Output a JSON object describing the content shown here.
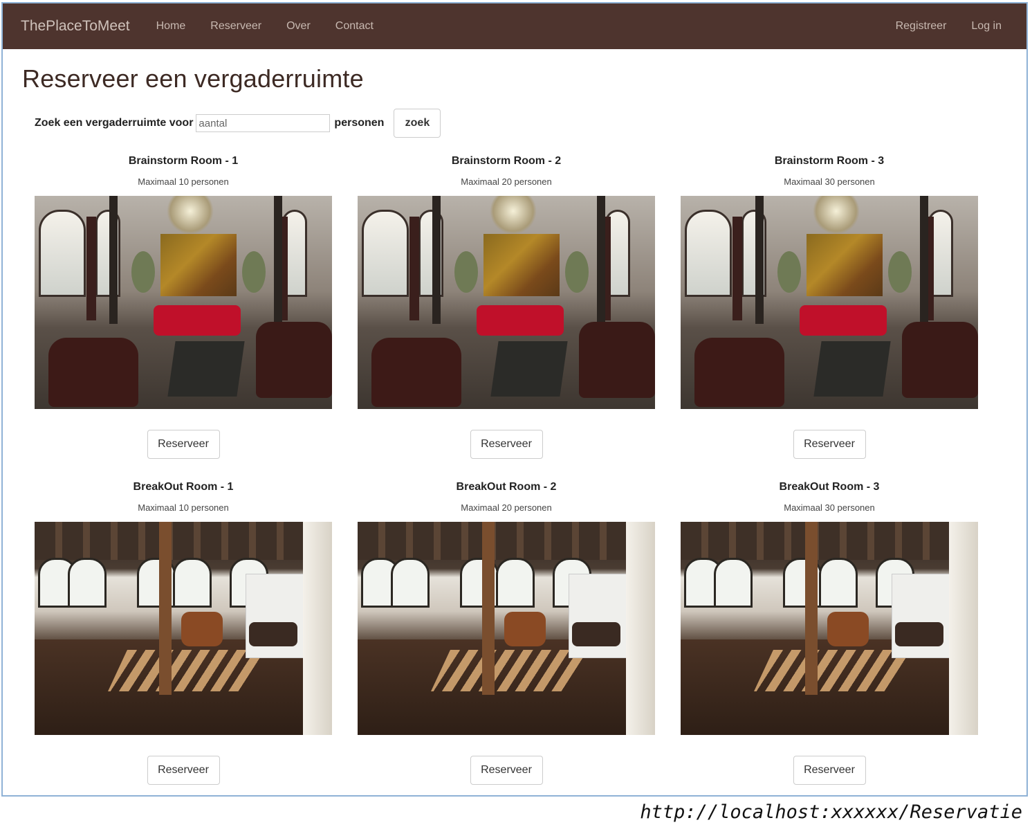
{
  "navbar": {
    "brand": "ThePlaceToMeet",
    "links": [
      "Home",
      "Reserveer",
      "Over",
      "Contact"
    ],
    "right_links": [
      "Registreer",
      "Log in"
    ]
  },
  "page": {
    "title": "Reserveer een vergaderruimte",
    "search": {
      "label_before": "Zoek een vergaderruimte voor",
      "placeholder": "aantal",
      "value": "",
      "label_after": "personen",
      "button": "zoek"
    }
  },
  "rooms": [
    {
      "name": "Brainstorm Room - 1",
      "capacity": "Maximaal 10 personen",
      "photo": "lounge-photo",
      "button": "Reserveer"
    },
    {
      "name": "Brainstorm Room - 2",
      "capacity": "Maximaal 20 personen",
      "photo": "lounge-photo",
      "button": "Reserveer"
    },
    {
      "name": "Brainstorm Room - 3",
      "capacity": "Maximaal 30 personen",
      "photo": "lounge-photo",
      "button": "Reserveer"
    },
    {
      "name": "BreakOut Room - 1",
      "capacity": "Maximaal 10 personen",
      "photo": "breakout-photo",
      "button": "Reserveer"
    },
    {
      "name": "BreakOut Room - 2",
      "capacity": "Maximaal 20 personen",
      "photo": "breakout-photo",
      "button": "Reserveer"
    },
    {
      "name": "BreakOut Room - 3",
      "capacity": "Maximaal 30 personen",
      "photo": "breakout-photo",
      "button": "Reserveer"
    }
  ],
  "caption": "http://localhost:xxxxxx/Reservatie",
  "colors": {
    "navbar": "#4e342e",
    "title": "#3d2a24"
  }
}
